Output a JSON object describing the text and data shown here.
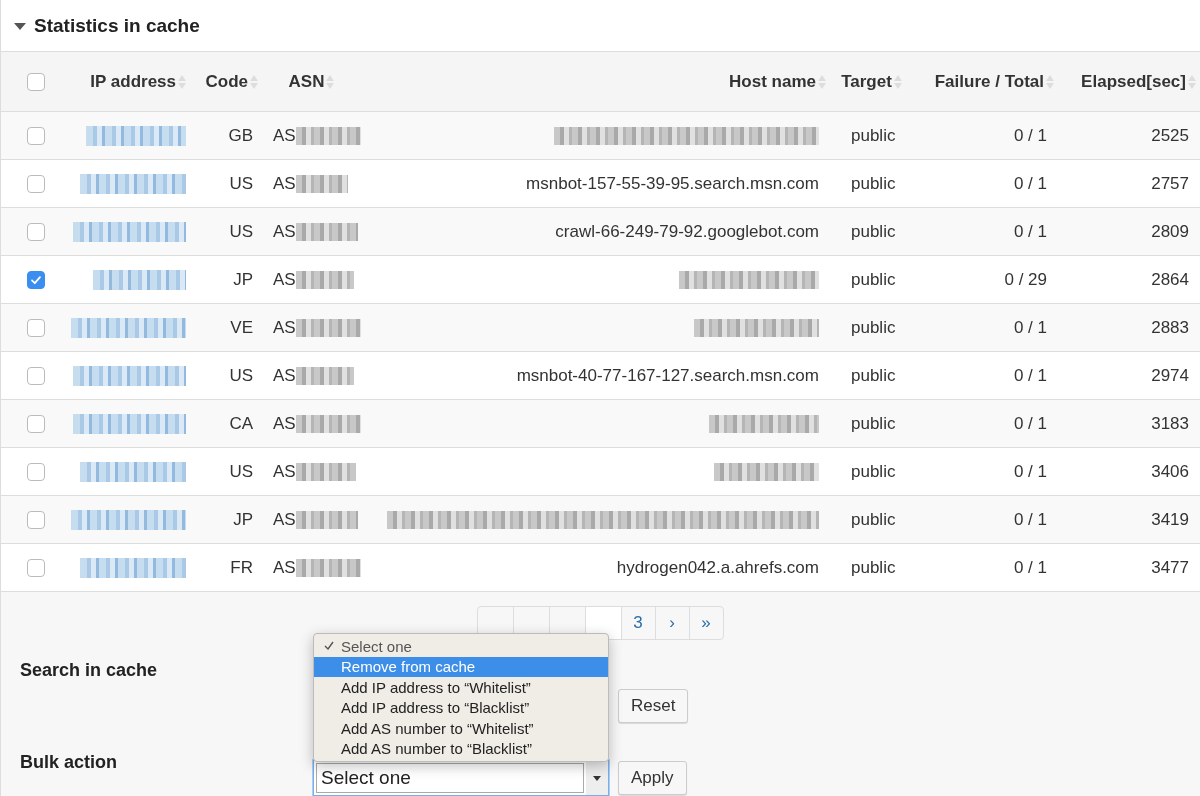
{
  "panel": {
    "title": "Statistics in cache",
    "expanded": true
  },
  "table": {
    "select_all": {
      "checked": false
    },
    "columns": [
      {
        "label": "IP address"
      },
      {
        "label": "Code"
      },
      {
        "label": "ASN"
      },
      {
        "label": "Host name"
      },
      {
        "label": "Target"
      },
      {
        "label": "Failure / Total"
      },
      {
        "label": "Elapsed[sec]"
      }
    ],
    "rows": [
      {
        "checked": false,
        "code": "GB",
        "asn": "AS",
        "target": "public",
        "failure_total": "0 / 1",
        "elapsed": "2525"
      },
      {
        "checked": false,
        "code": "US",
        "asn": "AS",
        "host_name": "msnbot-157-55-39-95.search.msn.com",
        "target": "public",
        "failure_total": "0 / 1",
        "elapsed": "2757"
      },
      {
        "checked": false,
        "code": "US",
        "asn": "AS",
        "host_name": "crawl-66-249-79-92.googlebot.com",
        "target": "public",
        "failure_total": "0 / 1",
        "elapsed": "2809"
      },
      {
        "checked": true,
        "code": "JP",
        "asn": "AS",
        "target": "public",
        "failure_total": "0 / 29",
        "elapsed": "2864"
      },
      {
        "checked": false,
        "code": "VE",
        "asn": "AS",
        "target": "public",
        "failure_total": "0 / 1",
        "elapsed": "2883"
      },
      {
        "checked": false,
        "code": "US",
        "asn": "AS",
        "host_name": "msnbot-40-77-167-127.search.msn.com",
        "target": "public",
        "failure_total": "0 / 1",
        "elapsed": "2974"
      },
      {
        "checked": false,
        "code": "CA",
        "asn": "AS",
        "target": "public",
        "failure_total": "0 / 1",
        "elapsed": "3183"
      },
      {
        "checked": false,
        "code": "US",
        "asn": "AS",
        "target": "public",
        "failure_total": "0 / 1",
        "elapsed": "3406"
      },
      {
        "checked": false,
        "code": "JP",
        "asn": "AS",
        "target": "public",
        "failure_total": "0 / 1",
        "elapsed": "3419"
      },
      {
        "checked": false,
        "code": "FR",
        "asn": "AS",
        "host_name": "hydrogen042.a.ahrefs.com",
        "target": "public",
        "failure_total": "0 / 1",
        "elapsed": "3477"
      }
    ]
  },
  "pagination": {
    "pages": [
      {
        "label": "3",
        "selected": false
      },
      {
        "label": "›",
        "selected": false
      },
      {
        "label": "»",
        "selected": false
      }
    ]
  },
  "search": {
    "label": "Search in cache",
    "reset_button": "Reset"
  },
  "bulk_action": {
    "label": "Bulk action",
    "value": "Select one",
    "apply_button": "Apply",
    "menu": {
      "open": true,
      "options": [
        {
          "label": "Select one",
          "checked": true,
          "highlighted": false
        },
        {
          "label": "Remove from cache",
          "checked": false,
          "highlighted": true
        },
        {
          "label": "Add IP address to “Whitelist”",
          "checked": false,
          "highlighted": false
        },
        {
          "label": "Add IP address to “Blacklist”",
          "checked": false,
          "highlighted": false
        },
        {
          "label": "Add AS number to “Whitelist”",
          "checked": false,
          "highlighted": false
        },
        {
          "label": "Add AS number to “Blacklist”",
          "checked": false,
          "highlighted": false
        }
      ]
    }
  }
}
